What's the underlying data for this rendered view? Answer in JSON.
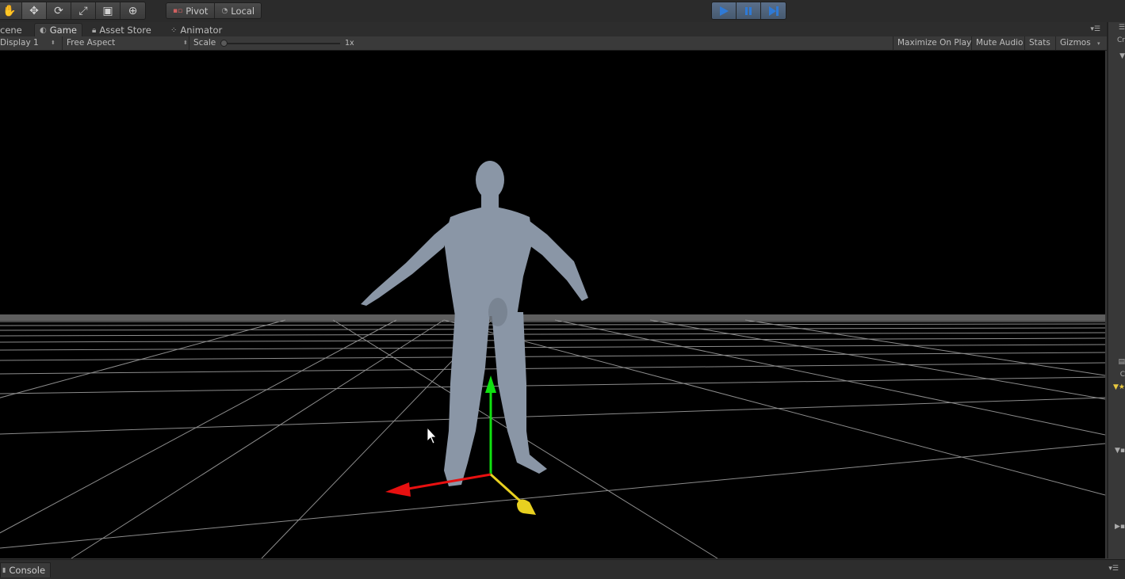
{
  "toolbar": {
    "transform_tools": [
      {
        "icon": "hand-icon",
        "glyph": "✋"
      },
      {
        "icon": "move-icon",
        "glyph": "✥"
      },
      {
        "icon": "rotate-icon",
        "glyph": "⟳"
      },
      {
        "icon": "scale-icon",
        "glyph": "⤢"
      },
      {
        "icon": "rect-tool-icon",
        "glyph": "▣"
      },
      {
        "icon": "transform-tool-icon",
        "glyph": "⊕"
      }
    ],
    "pivot_label": "Pivot",
    "local_label": "Local",
    "play_accent": "#2f7ad6"
  },
  "tabs": {
    "scene": "cene",
    "game": "Game",
    "asset_store": "Asset Store",
    "animator": "Animator"
  },
  "gamebar": {
    "display": "Display 1",
    "aspect": "Free Aspect",
    "scale_label": "Scale",
    "scale_value": "1x",
    "maximize": "Maximize On Play",
    "mute": "Mute Audio",
    "stats": "Stats",
    "gizmos": "Gizmos"
  },
  "right_panel": {
    "letters": [
      "Cr",
      "C"
    ],
    "star_color": "#e8c840"
  },
  "scene": {
    "character_color": "#8a96a6",
    "gizmo_x_color": "#e81010",
    "gizmo_y_color": "#10e010",
    "gizmo_z_color": "#e8d020"
  },
  "console": {
    "tab_label": "Console"
  }
}
